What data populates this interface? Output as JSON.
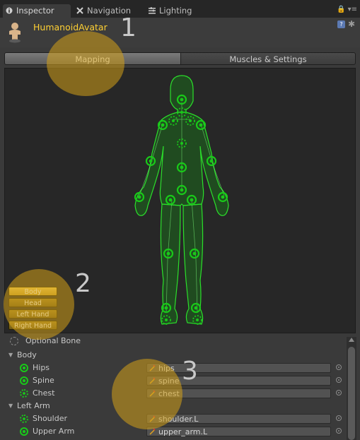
{
  "tabs": [
    {
      "label": "Inspector",
      "icon": "info-icon"
    },
    {
      "label": "Navigation",
      "icon": "navigation-icon"
    },
    {
      "label": "Lighting",
      "icon": "lighting-icon"
    }
  ],
  "header": {
    "title": "HumanoidAvatar"
  },
  "toolbar": {
    "mapping_label": "Mapping",
    "muscles_label": "Muscles & Settings"
  },
  "body_parts": [
    {
      "label": "Body",
      "selected": true
    },
    {
      "label": "Head",
      "selected": false
    },
    {
      "label": "Left Hand",
      "selected": false
    },
    {
      "label": "Right Hand",
      "selected": false
    }
  ],
  "annotations": [
    "1",
    "2",
    "3"
  ],
  "colors": {
    "accent": "#ffd033",
    "bone_green": "#19c919",
    "highlight": "#d4a017"
  },
  "list": {
    "optional_bone_label": "Optional Bone",
    "groups": [
      {
        "name": "Body",
        "bones": [
          {
            "label": "Hips",
            "value": "hips",
            "style": "solid"
          },
          {
            "label": "Spine",
            "value": "spine",
            "style": "solid"
          },
          {
            "label": "Chest",
            "value": "chest",
            "style": "dash"
          }
        ]
      },
      {
        "name": "Left Arm",
        "bones": [
          {
            "label": "Shoulder",
            "value": "shoulder.L",
            "style": "dash"
          },
          {
            "label": "Upper Arm",
            "value": "upper_arm.L",
            "style": "solid"
          }
        ]
      }
    ]
  }
}
